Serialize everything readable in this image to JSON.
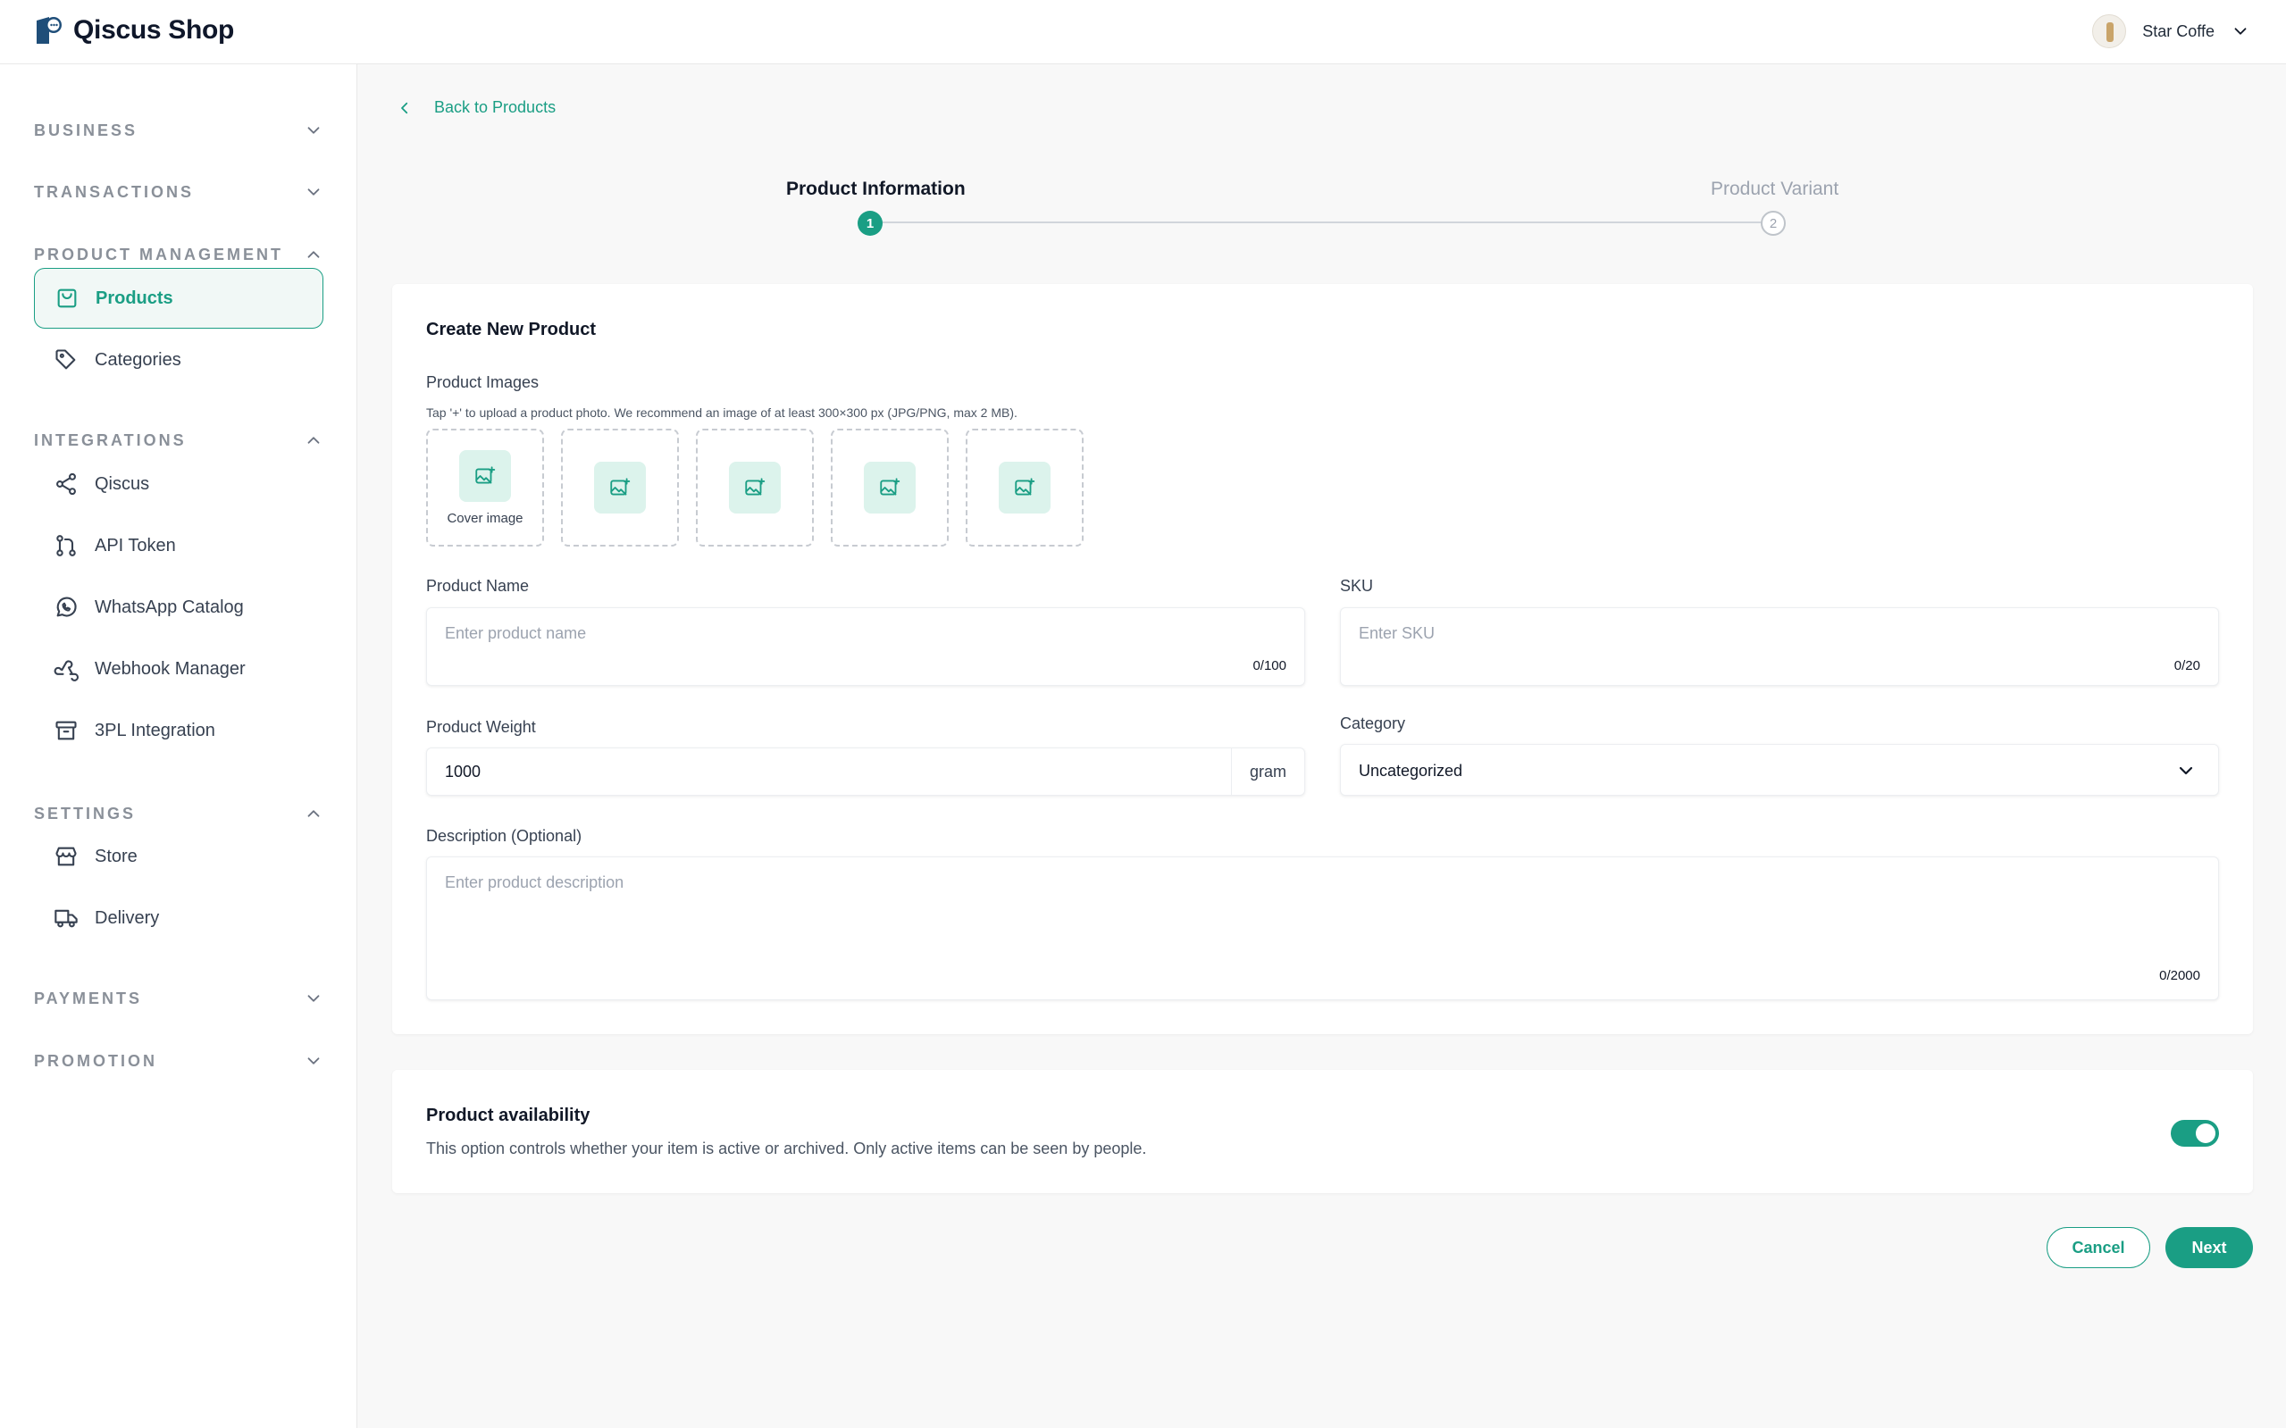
{
  "app": {
    "name": "Qiscus Shop"
  },
  "user": {
    "name": "Star Coffe"
  },
  "sidebar": {
    "sections": [
      {
        "label": "BUSINESS",
        "expanded": false
      },
      {
        "label": "TRANSACTIONS",
        "expanded": false
      },
      {
        "label": "PRODUCT MANAGEMENT",
        "expanded": true
      },
      {
        "label": "INTEGRATIONS",
        "expanded": true
      },
      {
        "label": "SETTINGS",
        "expanded": true
      },
      {
        "label": "PAYMENTS",
        "expanded": false
      },
      {
        "label": "PROMOTION",
        "expanded": false
      }
    ],
    "items": {
      "products": {
        "label": "Products",
        "icon": "shopping-bag-icon",
        "active": true
      },
      "categories": {
        "label": "Categories",
        "icon": "tag-icon"
      },
      "qiscus": {
        "label": "Qiscus",
        "icon": "share-icon"
      },
      "api_token": {
        "label": "API Token",
        "icon": "git-pull-request-icon"
      },
      "whatsapp_catalog": {
        "label": "WhatsApp Catalog",
        "icon": "whatsapp-icon"
      },
      "webhook_manager": {
        "label": "Webhook Manager",
        "icon": "webhook-icon"
      },
      "integration_3pl": {
        "label": "3PL Integration",
        "icon": "archive-icon"
      },
      "store": {
        "label": "Store",
        "icon": "store-icon"
      },
      "delivery": {
        "label": "Delivery",
        "icon": "truck-icon"
      }
    }
  },
  "back_link": {
    "label": "Back to Products"
  },
  "stepper": {
    "steps": [
      {
        "number": "1",
        "label": "Product Information",
        "active": true
      },
      {
        "number": "2",
        "label": "Product Variant",
        "active": false
      }
    ]
  },
  "form": {
    "title": "Create New Product",
    "images": {
      "label": "Product Images",
      "hint": "Tap '+' to upload a product photo. We recommend an image of at least 300×300 px (JPG/PNG, max 2 MB).",
      "cover_label": "Cover image",
      "slot_count": 5
    },
    "product_name": {
      "label": "Product Name",
      "placeholder": "Enter product name",
      "value": "",
      "counter": "0/100"
    },
    "sku": {
      "label": "SKU",
      "placeholder": "Enter SKU",
      "value": "",
      "counter": "0/20"
    },
    "weight": {
      "label": "Product Weight",
      "value": "1000",
      "unit": "gram"
    },
    "category": {
      "label": "Category",
      "value": "Uncategorized"
    },
    "description": {
      "label": "Description (Optional)",
      "placeholder": "Enter product description",
      "value": "",
      "counter": "0/2000"
    }
  },
  "availability": {
    "title": "Product availability",
    "description": "This option controls whether your item is active or archived. Only active items can be seen by people.",
    "enabled": true
  },
  "actions": {
    "cancel": "Cancel",
    "next": "Next"
  },
  "colors": {
    "accent": "#1a9e84",
    "accent_light": "#dcf3ec",
    "active_bg": "#f1f8f6"
  }
}
